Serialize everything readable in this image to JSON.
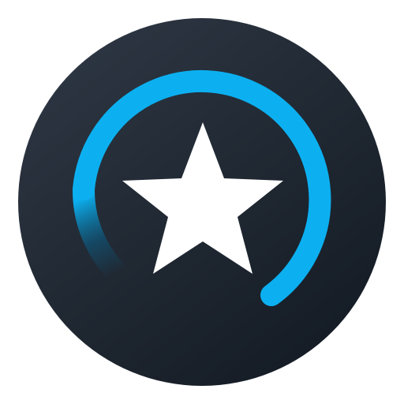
{
  "logo": {
    "icon": "star-progress-ring-icon",
    "colors": {
      "background_light": "#2b3440",
      "background_dark": "#141b24",
      "ring_accent": "#0cb0f0",
      "ring_fade": "#0a5f88",
      "star": "#ffffff"
    }
  }
}
